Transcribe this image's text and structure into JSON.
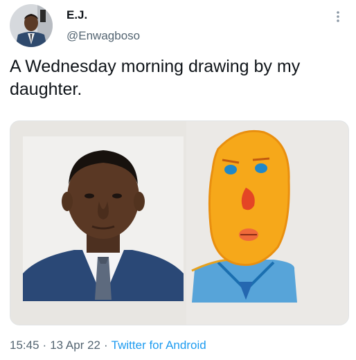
{
  "user": {
    "display_name": "E.J.",
    "handle": "@Enwagboso",
    "avatar_icon": "profile-photo-man-in-suit"
  },
  "tweet": {
    "text": "A Wednesday morning drawing by my daughter.",
    "time": "15:45",
    "date": "13 Apr 22",
    "separator": "·",
    "source": "Twitter for Android"
  },
  "media": {
    "left_image": "portrait-photo-man-in-blue-suit",
    "right_image": "child-drawing-orange-face-blue-suit"
  },
  "icons": {
    "more": "more-vertical-icon"
  },
  "colors": {
    "link": "#1d9bf0",
    "secondary_text": "#536471",
    "primary_text": "#0f1419"
  }
}
